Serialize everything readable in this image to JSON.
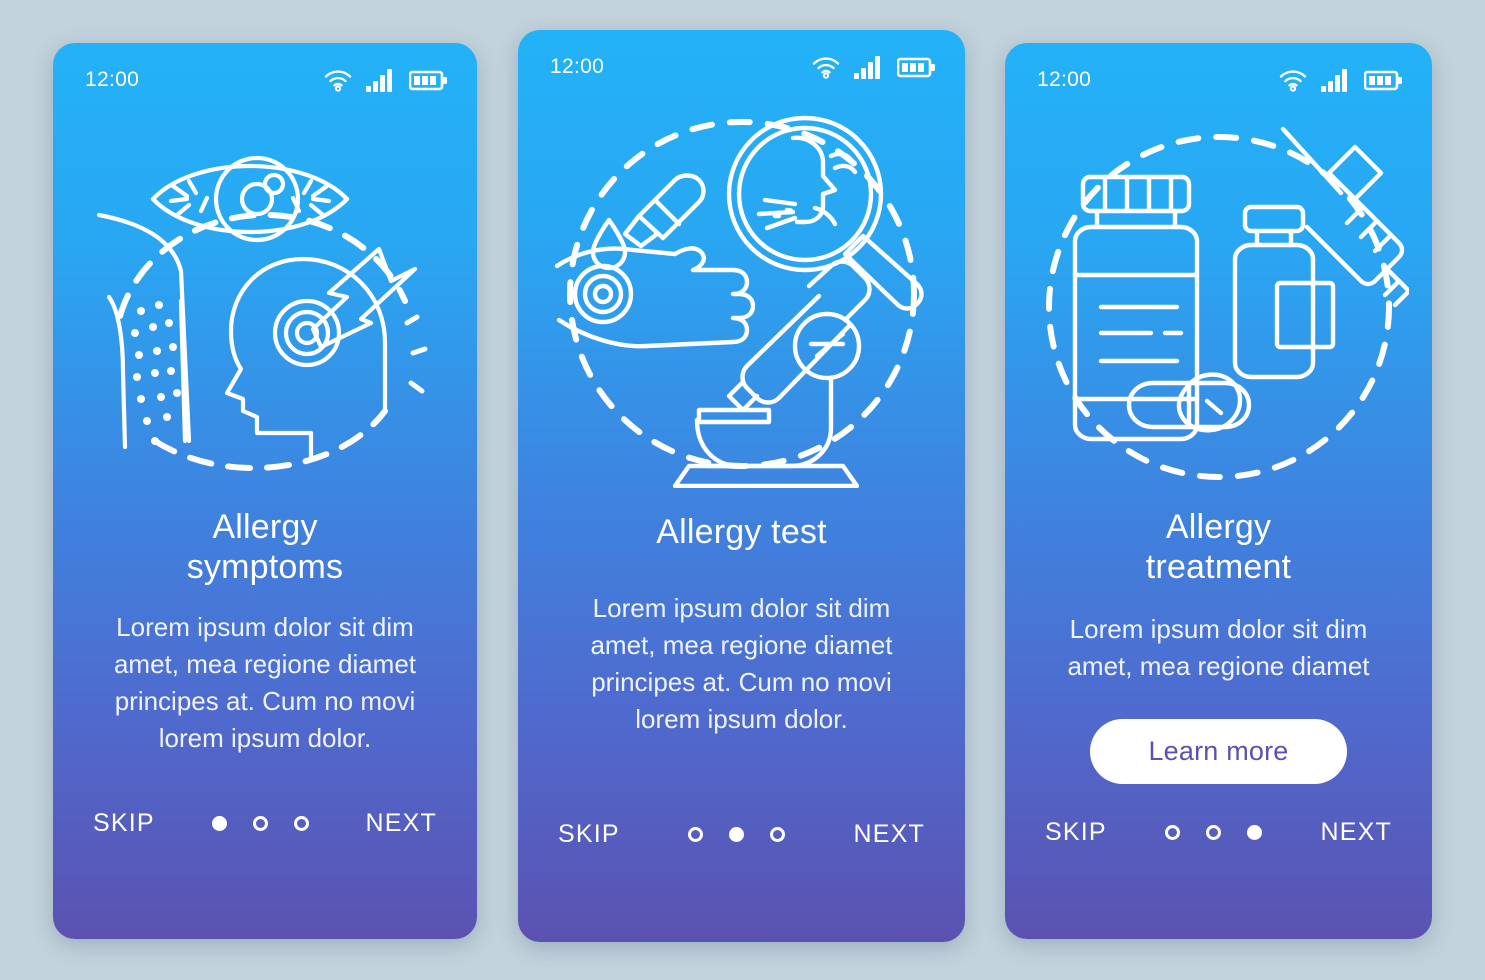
{
  "background_color": "#c3d3dc",
  "card_gradient": {
    "top": "#23b2f7",
    "bottom": "#5b52b0"
  },
  "accent_white": "#ffffff",
  "button_text_color": "#5b52b0",
  "status_bar": {
    "time": "12:00",
    "icons": [
      "wifi-icon",
      "cellular-signal-icon",
      "battery-icon"
    ]
  },
  "screens": [
    {
      "id": "allergy-symptoms",
      "illustration_name": "allergy-symptoms-illustration",
      "illustration_elements": [
        "eye-icon",
        "arm-rash-icon",
        "head-profile-icon",
        "lightning-bolt-icon",
        "target-icon",
        "dashed-circle"
      ],
      "title": "Allergy\nsymptoms",
      "description": "Lorem ipsum dolor sit dim\namet, mea regione diamet\nprincipes at. Cum no movi\nlorem ipsum dolor.",
      "has_button": false,
      "button_label": "",
      "skip_label": "SKIP",
      "next_label": "NEXT",
      "dots": [
        true,
        false,
        false
      ]
    },
    {
      "id": "allergy-test",
      "illustration_name": "allergy-test-illustration",
      "illustration_elements": [
        "dropper-icon",
        "drop-icon",
        "hand-icon",
        "reaction-circle-icon",
        "magnifier-icon",
        "sneezing-face-icon",
        "microscope-icon",
        "dashed-circle"
      ],
      "title": "Allergy test",
      "description": "Lorem ipsum dolor sit dim\namet, mea regione diamet\nprincipes at. Cum no movi\nlorem ipsum dolor.",
      "has_button": false,
      "button_label": "",
      "skip_label": "SKIP",
      "next_label": "NEXT",
      "dots": [
        false,
        true,
        false
      ]
    },
    {
      "id": "allergy-treatment",
      "illustration_name": "allergy-treatment-illustration",
      "illustration_elements": [
        "pill-bottle-icon",
        "vial-icon",
        "syringe-icon",
        "capsule-icon",
        "dashed-circle"
      ],
      "title": "Allergy\ntreatment",
      "description": "Lorem ipsum dolor sit dim\namet, mea regione diamet",
      "has_button": true,
      "button_label": "Learn more",
      "skip_label": "SKIP",
      "next_label": "NEXT",
      "dots": [
        false,
        false,
        true
      ]
    }
  ]
}
